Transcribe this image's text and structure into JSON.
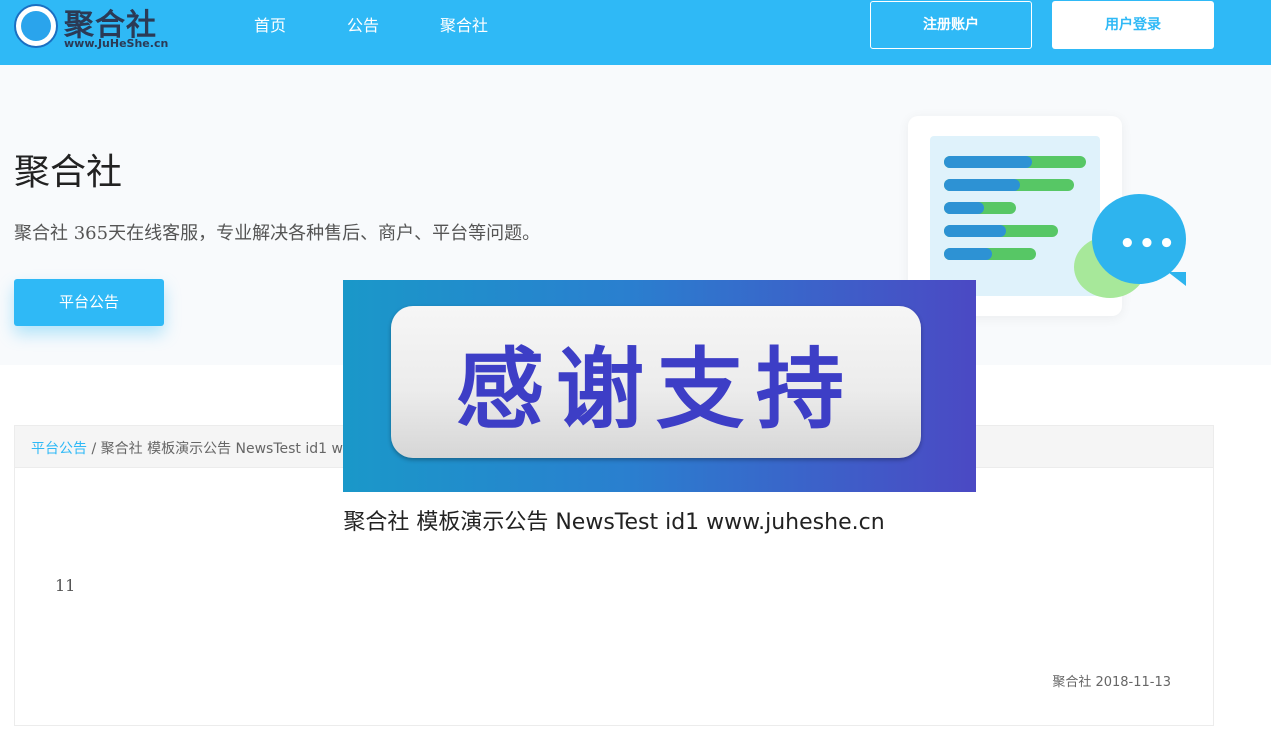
{
  "header": {
    "logo_text": "聚合社",
    "logo_sub": "www.JuHeShe.cn",
    "nav": [
      "首页",
      "公告",
      "聚合社"
    ],
    "register_label": "注册账户",
    "login_label": "用户登录",
    "bg_color": "#2fb9f6"
  },
  "hero": {
    "title": "聚合社",
    "description": "聚合社 365天在线客服，专业解决各种售后、商户、平台等问题。",
    "button_label": "平台公告"
  },
  "breadcrumb": {
    "root": "平台公告",
    "separator": "/",
    "current": "聚合社 模板演示公告 NewsTest id1 www.juheshe.cn"
  },
  "article": {
    "title": "聚合社 模板演示公告 NewsTest id1 www.juheshe.cn",
    "body": "11",
    "footer": "聚合社 2018-11-13"
  },
  "banner": {
    "text": "感谢支持"
  }
}
